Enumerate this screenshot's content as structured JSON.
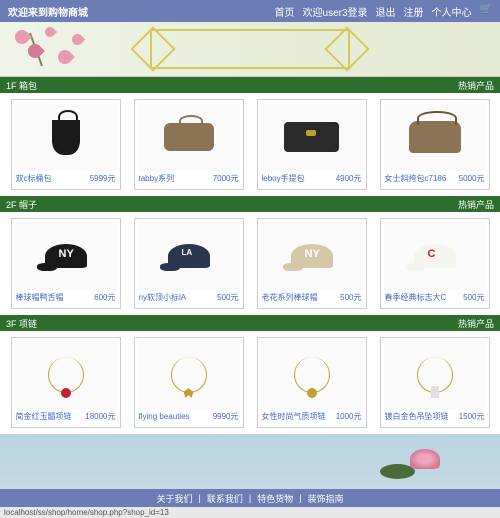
{
  "header": {
    "welcome": "欢迎来到购物商城",
    "nav": {
      "home": "首页",
      "user_status": "欢迎user3登录",
      "logout": "退出",
      "register": "注册",
      "account": "个人中心"
    }
  },
  "sections": [
    {
      "title": "1F 箱包",
      "hot": "热销产品",
      "items": [
        {
          "name": "双c标桶包",
          "price": "5999元"
        },
        {
          "name": "tabby系列",
          "price": "7000元"
        },
        {
          "name": "leboy手提包",
          "price": "4900元"
        },
        {
          "name": "女士斜挎包c7186",
          "price": "5000元"
        }
      ]
    },
    {
      "title": "2F 帽子",
      "hot": "热销产品",
      "items": [
        {
          "name": "棒球帽鸭舌帽",
          "price": "600元"
        },
        {
          "name": "ny软顶小标lA",
          "price": "500元"
        },
        {
          "name": "老花系列棒球帽",
          "price": "500元"
        },
        {
          "name": "春季经典标志大C",
          "price": "500元"
        }
      ]
    },
    {
      "title": "3F 项链",
      "hot": "热销产品",
      "items": [
        {
          "name": "简金红玉髓项链",
          "price": "18000元"
        },
        {
          "name": "flying beauties",
          "price": "9990元"
        },
        {
          "name": "女性时尚气质项链",
          "price": "1000元"
        },
        {
          "name": "镀白金色吊坠项链",
          "price": "1500元"
        }
      ]
    }
  ],
  "footer": {
    "about": "关于我们",
    "contact": "联系我们",
    "promo": "特色货物",
    "guide": "装饰指南"
  },
  "status_bar": "localhost/ss/shop/home/shop.php?shop_id=13"
}
